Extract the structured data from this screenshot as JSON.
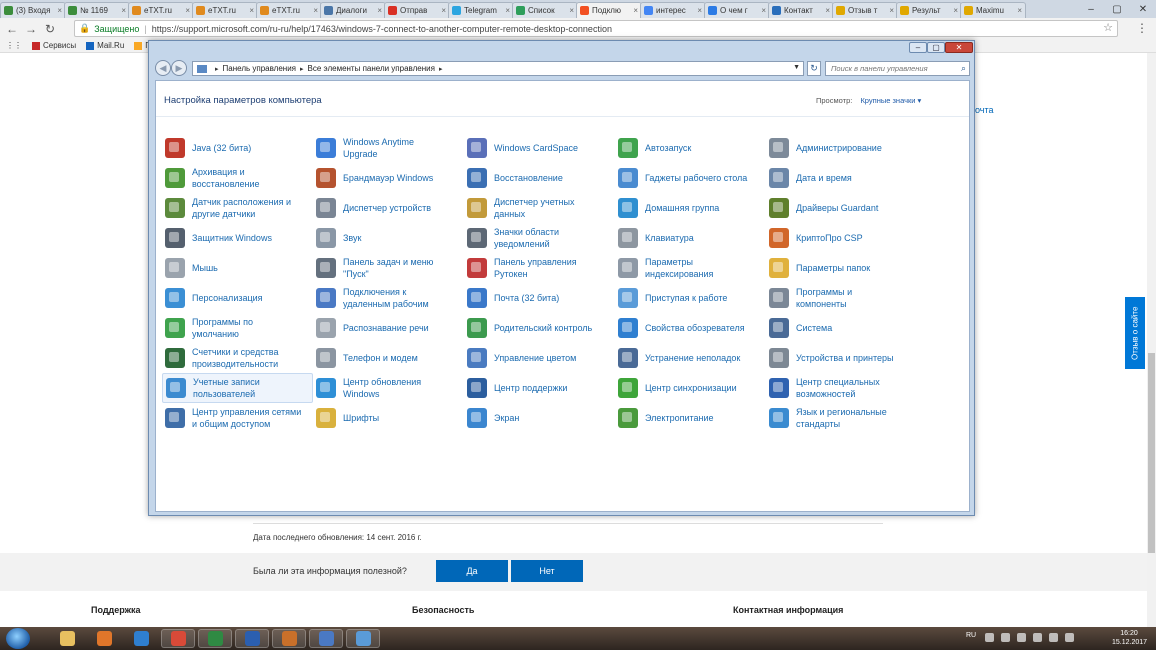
{
  "browser": {
    "tabs": [
      {
        "label": "(3) Входя",
        "color": "#3c8d3c"
      },
      {
        "label": "№ 1169",
        "color": "#3c8d3c"
      },
      {
        "label": "eTXT.ru",
        "color": "#e08a1e"
      },
      {
        "label": "eTXT.ru",
        "color": "#e08a1e"
      },
      {
        "label": "eTXT.ru",
        "color": "#e08a1e"
      },
      {
        "label": "Диалоги",
        "color": "#4a76a8"
      },
      {
        "label": "Отправ",
        "color": "#d93025"
      },
      {
        "label": "Telegram",
        "color": "#2ca5e0"
      },
      {
        "label": "Список",
        "color": "#2e9e5b"
      },
      {
        "label": "Подклю",
        "color": "#f25022",
        "active": true
      },
      {
        "label": "интерес",
        "color": "#4285f4"
      },
      {
        "label": "О чем г",
        "color": "#2c7be5"
      },
      {
        "label": "Контакт",
        "color": "#2a6ebb"
      },
      {
        "label": "Отзыв т",
        "color": "#e0a800"
      },
      {
        "label": "Результ",
        "color": "#e0a800"
      },
      {
        "label": "Maximu",
        "color": "#e0a800"
      }
    ],
    "nav": {
      "back": "←",
      "forward": "→",
      "reload": "↻"
    },
    "address": {
      "secure_label": "Защищено",
      "separator": "|",
      "url": "https://support.microsoft.com/ru-ru/help/17463/windows-7-connect-to-another-computer-remote-desktop-connection"
    },
    "bookmarks": [
      {
        "label": "Сервисы",
        "color": "#c62828"
      },
      {
        "label": "Mail.Ru",
        "color": "#1565c0"
      },
      {
        "label": "Поиск в",
        "color": "#f9a825"
      }
    ]
  },
  "page": {
    "partial_link": "очта",
    "updated": "Дата последнего обновления: 14 сент. 2016 г.",
    "feedback_question": "Была ли эта информация полезной?",
    "yes": "Да",
    "no": "Нет",
    "footer": [
      "Поддержка",
      "Безопасность",
      "Контактная информация"
    ],
    "site_feedback": "Отзыв о сайте"
  },
  "control_panel": {
    "window_controls": {
      "minimize": "–",
      "maximize": "▢",
      "close": "✕"
    },
    "breadcrumb": [
      "Панель управления",
      "Все элементы панели управления"
    ],
    "search_placeholder": "Поиск в панели управления",
    "title": "Настройка параметров компьютера",
    "view_label": "Просмотр:",
    "view_value": "Крупные значки",
    "items": [
      {
        "label": "Java (32 бита)",
        "icon": "java-icon",
        "color": "#c0392b"
      },
      {
        "label": "Windows Anytime\nUpgrade",
        "icon": "upgrade-icon",
        "color": "#3b7dd8"
      },
      {
        "label": "Windows CardSpace",
        "icon": "cardspace-icon",
        "color": "#5a6fb8"
      },
      {
        "label": "Автозапуск",
        "icon": "autoplay-icon",
        "color": "#3fa34d"
      },
      {
        "label": "Администрирование",
        "icon": "admin-tools-icon",
        "color": "#7d8a99"
      },
      {
        "label": "Архивация и\nвосстановление",
        "icon": "backup-icon",
        "color": "#4f9a3a"
      },
      {
        "label": "Брандмауэр Windows",
        "icon": "firewall-icon",
        "color": "#b5532f"
      },
      {
        "label": "Восстановление",
        "icon": "recovery-icon",
        "color": "#3b6fb3"
      },
      {
        "label": "Гаджеты рабочего стола",
        "icon": "gadgets-icon",
        "color": "#4a8bd0"
      },
      {
        "label": "Дата и время",
        "icon": "datetime-icon",
        "color": "#6b86a8"
      },
      {
        "label": "Датчик расположения и\nдругие датчики",
        "icon": "sensor-icon",
        "color": "#5c8a3c"
      },
      {
        "label": "Диспетчер устройств",
        "icon": "device-manager-icon",
        "color": "#7a8594"
      },
      {
        "label": "Диспетчер учетных\nданных",
        "icon": "credential-icon",
        "color": "#c29a3a"
      },
      {
        "label": "Домашняя группа",
        "icon": "homegroup-icon",
        "color": "#2f8fd0"
      },
      {
        "label": "Драйверы Guardant",
        "icon": "guardant-icon",
        "color": "#5f7f2c"
      },
      {
        "label": "Защитник Windows",
        "icon": "defender-icon",
        "color": "#55606e"
      },
      {
        "label": "Звук",
        "icon": "sound-icon",
        "color": "#8a97a6"
      },
      {
        "label": "Значки области\nуведомлений",
        "icon": "tray-icons-icon",
        "color": "#5d6875"
      },
      {
        "label": "Клавиатура",
        "icon": "keyboard-icon",
        "color": "#8d96a0"
      },
      {
        "label": "КриптоПро CSP",
        "icon": "cryptopro-icon",
        "color": "#d1662a"
      },
      {
        "label": "Мышь",
        "icon": "mouse-icon",
        "color": "#9aa3ad"
      },
      {
        "label": "Панель задач и меню\n\"Пуск\"",
        "icon": "taskbar-icon",
        "color": "#64707e"
      },
      {
        "label": "Панель управления\nРутокен",
        "icon": "rutoken-icon",
        "color": "#c23b3b"
      },
      {
        "label": "Параметры\nиндексирования",
        "icon": "indexing-icon",
        "color": "#8e99a6"
      },
      {
        "label": "Параметры папок",
        "icon": "folder-options-icon",
        "color": "#e0b13d"
      },
      {
        "label": "Персонализация",
        "icon": "personalization-icon",
        "color": "#3b8fd4"
      },
      {
        "label": "Подключения к\nудаленным рабочим",
        "icon": "remote-desktop-icon",
        "color": "#4a79c4"
      },
      {
        "label": "Почта (32 бита)",
        "icon": "mail-icon",
        "color": "#3a78c9"
      },
      {
        "label": "Приступая к работе",
        "icon": "getting-started-icon",
        "color": "#5a9bd8"
      },
      {
        "label": "Программы и\nкомпоненты",
        "icon": "programs-icon",
        "color": "#7b8796"
      },
      {
        "label": "Программы по\nумолчанию",
        "icon": "default-programs-icon",
        "color": "#3fa34d"
      },
      {
        "label": "Распознавание речи",
        "icon": "speech-icon",
        "color": "#9aa3ad"
      },
      {
        "label": "Родительский контроль",
        "icon": "parental-control-icon",
        "color": "#3c9a4e"
      },
      {
        "label": "Свойства обозревателя",
        "icon": "internet-options-icon",
        "color": "#2f7fd0"
      },
      {
        "label": "Система",
        "icon": "system-icon",
        "color": "#4a6a96"
      },
      {
        "label": "Счетчики и средства\nпроизводительности",
        "icon": "performance-icon",
        "color": "#2f6b3c"
      },
      {
        "label": "Телефон и модем",
        "icon": "phone-modem-icon",
        "color": "#8b95a1"
      },
      {
        "label": "Управление цветом",
        "icon": "color-management-icon",
        "color": "#4a7bc0"
      },
      {
        "label": "Устранение неполадок",
        "icon": "troubleshooting-icon",
        "color": "#4a6a96"
      },
      {
        "label": "Устройства и принтеры",
        "icon": "printers-icon",
        "color": "#7d8894"
      },
      {
        "label": "Учетные записи\nпользователей",
        "icon": "user-accounts-icon",
        "color": "#3c8bd0",
        "highlight": true
      },
      {
        "label": "Центр обновления\nWindows",
        "icon": "windows-update-icon",
        "color": "#2e8fd6"
      },
      {
        "label": "Центр поддержки",
        "icon": "action-center-icon",
        "color": "#2c5e9e"
      },
      {
        "label": "Центр синхронизации",
        "icon": "sync-center-icon",
        "color": "#3ea53a"
      },
      {
        "label": "Центр специальных\nвозможностей",
        "icon": "accessibility-icon",
        "color": "#2f62b0"
      },
      {
        "label": "Центр управления сетями\nи общим доступом",
        "icon": "network-center-icon",
        "color": "#3f6ea8"
      },
      {
        "label": "Шрифты",
        "icon": "fonts-icon",
        "color": "#d9b13d"
      },
      {
        "label": "Экран",
        "icon": "display-icon",
        "color": "#3b86cf"
      },
      {
        "label": "Электропитание",
        "icon": "power-options-icon",
        "color": "#4a9a3c"
      },
      {
        "label": "Язык и региональные\nстандарты",
        "icon": "region-icon",
        "color": "#3a8bd0"
      }
    ]
  },
  "taskbar": {
    "apps": [
      {
        "icon": "explorer-icon",
        "color": "#e8c060"
      },
      {
        "icon": "media-player-icon",
        "color": "#e0762a"
      },
      {
        "icon": "internet-explorer-icon",
        "color": "#2f7fd0"
      },
      {
        "icon": "chrome-icon",
        "color": "#d94a38",
        "open": true
      },
      {
        "icon": "excel-icon",
        "color": "#2f8a43",
        "open": true
      },
      {
        "icon": "word-icon",
        "color": "#2b5fb0",
        "open": true
      },
      {
        "icon": "java-icon",
        "color": "#c9702a",
        "open": true
      },
      {
        "icon": "remote-desktop-icon",
        "color": "#4a79c4",
        "open": true
      },
      {
        "icon": "control-panel-icon",
        "color": "#5a9bd8",
        "open": true
      }
    ],
    "lang": "RU",
    "time": "16:20",
    "date": "15.12.2017"
  }
}
